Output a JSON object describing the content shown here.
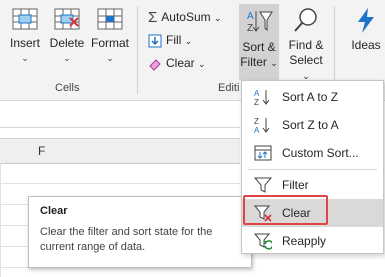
{
  "ribbon": {
    "insert_label": "Insert",
    "delete_label": "Delete",
    "format_label": "Format",
    "cells_group": "Cells",
    "autosum_label": "AutoSum",
    "fill_label": "Fill",
    "clear_label": "Clear",
    "editing_group": "Editi",
    "sort_filter_line1": "Sort &",
    "sort_filter_line2": "Filter",
    "find_select_line1": "Find &",
    "find_select_line2": "Select",
    "ideas_label": "Ideas"
  },
  "sheet": {
    "column_f": "F"
  },
  "menu": {
    "items": [
      {
        "label": "Sort A to Z",
        "icon": "sort-a-z-icon"
      },
      {
        "label": "Sort Z to A",
        "icon": "sort-z-a-icon"
      },
      {
        "label": "Custom Sort...",
        "icon": "custom-sort-icon"
      },
      {
        "label": "Filter",
        "icon": "filter-icon"
      },
      {
        "label": "Clear",
        "icon": "clear-filter-icon"
      },
      {
        "label": "Reapply",
        "icon": "reapply-icon"
      }
    ]
  },
  "tooltip": {
    "title": "Clear",
    "description": "Clear the filter and sort state for the current range of data."
  },
  "colors": {
    "highlight_border": "#e04545",
    "hover_bg": "#d9d9d9",
    "accent_blue": "#1e73c8",
    "icon_red": "#d13438",
    "icon_green": "#1e8a3c"
  }
}
